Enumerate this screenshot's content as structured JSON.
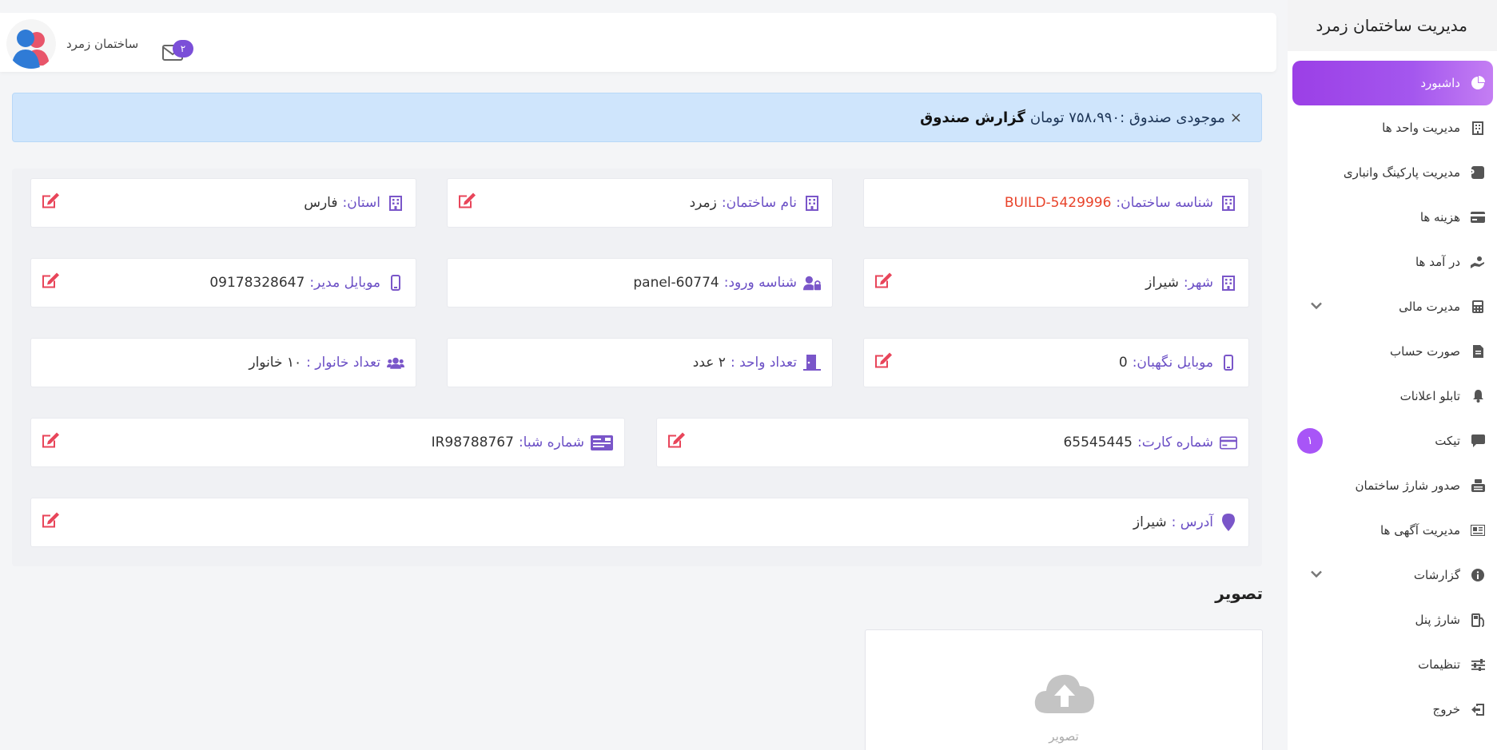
{
  "sidebar": {
    "brand": "مدیریت ساختمان زمرد",
    "items": [
      {
        "label": "داشبورد"
      },
      {
        "label": "مدیریت واحد ها"
      },
      {
        "label": "مدیریت پارکینگ وانباری"
      },
      {
        "label": "هزینه ها"
      },
      {
        "label": "در آمد ها"
      },
      {
        "label": "مدیرت مالی"
      },
      {
        "label": "صورت حساب"
      },
      {
        "label": "تابلو اعلانات"
      },
      {
        "label": "تیکت",
        "badge": "۱"
      },
      {
        "label": "صدور شارژ ساختمان"
      },
      {
        "label": "مدیریت آگهی ها"
      },
      {
        "label": "گزارشات"
      },
      {
        "label": "شارژ پنل"
      },
      {
        "label": "تنظیمات"
      },
      {
        "label": "خروج"
      }
    ]
  },
  "header": {
    "username": "ساختمان زمرد",
    "mail_count": "۲"
  },
  "alert": {
    "close": "×",
    "text": "موجودی صندوق :۷۵۸،۹۹۰ تومان",
    "link": "گزارش صندوق"
  },
  "fields": {
    "building_id": {
      "label": "شناسه ساختمان:",
      "value": "BUILD-5429996"
    },
    "building_name": {
      "label": "نام ساختمان:",
      "value": "زمرد"
    },
    "province": {
      "label": "استان:",
      "value": "فارس"
    },
    "city": {
      "label": "شهر:",
      "value": "شیراز"
    },
    "login_id": {
      "label": "شناسه ورود:",
      "value": "panel-60774"
    },
    "manager_mobile": {
      "label": "موبایل مدیر:",
      "value": "09178328647"
    },
    "guard_mobile": {
      "label": "موبایل نگهبان:",
      "value": "0"
    },
    "unit_count": {
      "label": "تعداد واحد :",
      "value": "۲ عدد"
    },
    "household_count": {
      "label": "تعداد خانوار :",
      "value": "۱۰ خانوار"
    },
    "card_number": {
      "label": "شماره کارت:",
      "value": "65545445"
    },
    "sheba": {
      "label": "شماره شبا:",
      "value": "IR98788767"
    },
    "address": {
      "label": "آدرس :",
      "value": "شیراز"
    }
  },
  "image_section": {
    "title": "تصویر",
    "upload_caption": "تصویر"
  },
  "colors": {
    "accent": "#a457ee",
    "label": "#6b4fc5",
    "edit": "#e8455a",
    "alert_bg": "#cfe5fc"
  }
}
